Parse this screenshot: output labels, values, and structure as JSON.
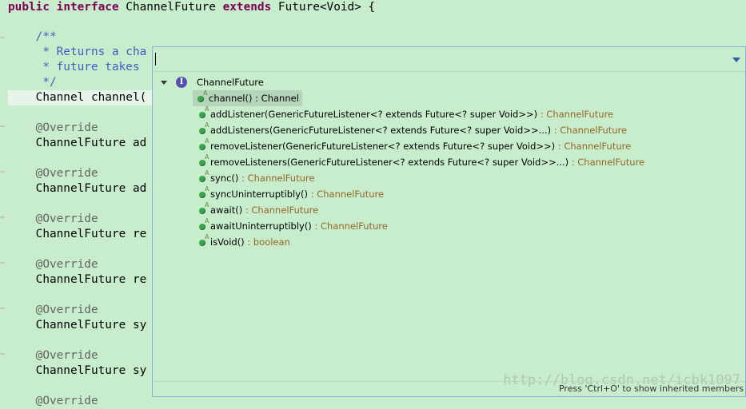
{
  "editor": {
    "lines": [
      {
        "parts": [
          {
            "t": "public ",
            "c": "kw"
          },
          {
            "t": "interface ",
            "c": "kw"
          },
          {
            "t": "ChannelFuture ",
            "c": ""
          },
          {
            "t": "extends ",
            "c": "kw"
          },
          {
            "t": "Future<Void> {",
            "c": ""
          }
        ]
      },
      {
        "parts": [
          {
            "t": "    /**",
            "c": "cm"
          }
        ]
      },
      {
        "parts": [
          {
            "t": "     * Returns a cha",
            "c": "cm"
          }
        ]
      },
      {
        "parts": [
          {
            "t": "     * future takes",
            "c": "cm"
          }
        ]
      },
      {
        "parts": [
          {
            "t": "     */",
            "c": "cm"
          }
        ]
      },
      {
        "parts": [
          {
            "t": "    Channel channel(",
            "c": ""
          }
        ]
      },
      {
        "parts": [
          {
            "t": "    @Override",
            "c": "an"
          }
        ]
      },
      {
        "parts": [
          {
            "t": "    ChannelFuture ad",
            "c": ""
          }
        ]
      },
      {
        "parts": [
          {
            "t": "    @Override",
            "c": "an"
          }
        ]
      },
      {
        "parts": [
          {
            "t": "    ChannelFuture ad",
            "c": ""
          }
        ]
      },
      {
        "parts": [
          {
            "t": "    @Override",
            "c": "an"
          }
        ]
      },
      {
        "parts": [
          {
            "t": "    ChannelFuture re",
            "c": ""
          }
        ]
      },
      {
        "parts": [
          {
            "t": "    @Override",
            "c": "an"
          }
        ]
      },
      {
        "parts": [
          {
            "t": "    ChannelFuture re",
            "c": ""
          }
        ]
      },
      {
        "parts": [
          {
            "t": "    @Override",
            "c": "an"
          }
        ]
      },
      {
        "parts": [
          {
            "t": "    ChannelFuture sy",
            "c": ""
          }
        ]
      },
      {
        "parts": [
          {
            "t": "    @Override",
            "c": "an"
          }
        ]
      },
      {
        "parts": [
          {
            "t": "    ChannelFuture sy",
            "c": ""
          }
        ]
      },
      {
        "parts": [
          {
            "t": "    @Override",
            "c": "an"
          }
        ]
      }
    ]
  },
  "outline": {
    "filter_value": "",
    "root_icon": "interface-icon",
    "root_icon_glyph": "I",
    "root_label": "ChannelFuture",
    "members": [
      {
        "name": "channel()",
        "type": " : Channel",
        "selected": true
      },
      {
        "name": "addListener(GenericFutureListener<? extends Future<? super Void>>)",
        "type": " : ChannelFuture",
        "selected": false
      },
      {
        "name": "addListeners(GenericFutureListener<? extends Future<? super Void>>...)",
        "type": " : ChannelFuture",
        "selected": false
      },
      {
        "name": "removeListener(GenericFutureListener<? extends Future<? super Void>>)",
        "type": " : ChannelFuture",
        "selected": false
      },
      {
        "name": "removeListeners(GenericFutureListener<? extends Future<? super Void>>...)",
        "type": " : ChannelFuture",
        "selected": false
      },
      {
        "name": "sync()",
        "type": " : ChannelFuture",
        "selected": false
      },
      {
        "name": "syncUninterruptibly()",
        "type": " : ChannelFuture",
        "selected": false
      },
      {
        "name": "await()",
        "type": " : ChannelFuture",
        "selected": false
      },
      {
        "name": "awaitUninterruptibly()",
        "type": " : ChannelFuture",
        "selected": false
      },
      {
        "name": "isVoid()",
        "type": " : boolean",
        "selected": false
      }
    ],
    "abstract_mark": "A",
    "status_text": "Press 'Ctrl+O' to show inherited members"
  },
  "watermark": "http://blog.csdn.net/icbk1097",
  "colors": {
    "background": "#c7edcc",
    "keyword": "#7f0055",
    "comment": "#3f5fbf",
    "annotation": "#646464",
    "return_type": "#95662a",
    "method_public": "#3ea34a"
  }
}
